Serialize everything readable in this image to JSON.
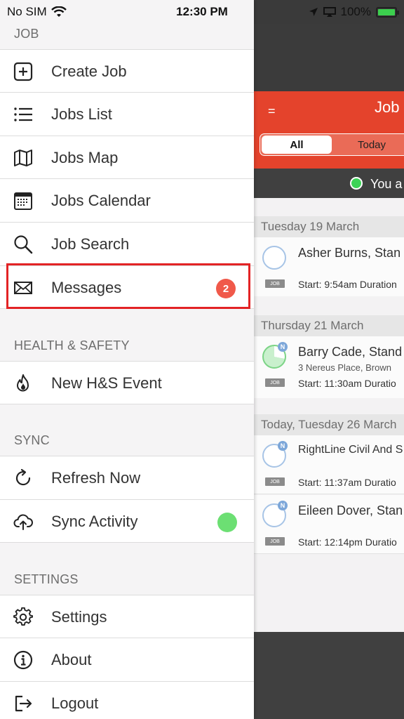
{
  "status_bar": {
    "carrier": "No SIM",
    "time": "12:30 PM",
    "battery": "100%"
  },
  "app": {
    "title": "Job",
    "menu_glyph": "=",
    "segments": {
      "all": "All",
      "today": "Today"
    },
    "online_text": "You a",
    "groups": [
      {
        "date": "Tuesday 19 March",
        "jobs": [
          {
            "title": "Asher Burns, Stan",
            "address": "",
            "tag": "JOB",
            "start": "Start: 9:54am  Duration",
            "badge": ""
          }
        ]
      },
      {
        "date": "Thursday 21 March",
        "jobs": [
          {
            "title": "Barry Cade, Stand",
            "address": "3 Nereus Place, Brown",
            "tag": "JOB",
            "start": "Start: 11:30am  Duratio",
            "badge": "N"
          }
        ]
      },
      {
        "date": "Today, Tuesday 26 March",
        "jobs": [
          {
            "title": "RightLine Civil And S",
            "address": "",
            "tag": "JOB",
            "start": "Start: 11:37am  Duratio",
            "badge": "N"
          },
          {
            "title": "Eileen Dover, Stan",
            "address": "",
            "tag": "JOB",
            "start": "Start: 12:14pm  Duratio",
            "badge": "N"
          }
        ]
      }
    ]
  },
  "drawer": {
    "sections": {
      "job": "JOB",
      "health_safety": "HEALTH & SAFETY",
      "sync": "SYNC",
      "settings": "SETTINGS"
    },
    "items": {
      "create_job": "Create Job",
      "jobs_list": "Jobs List",
      "jobs_map": "Jobs Map",
      "jobs_calendar": "Jobs Calendar",
      "job_search": "Job Search",
      "messages": "Messages",
      "messages_badge": "2",
      "new_hs_event": "New H&S Event",
      "refresh_now": "Refresh Now",
      "sync_activity": "Sync Activity",
      "settings": "Settings",
      "about": "About",
      "logout": "Logout"
    },
    "colors": {
      "accent": "#e4432c",
      "badge": "#f0594a",
      "sync_ok": "#6cdf73",
      "highlight": "#e32325"
    }
  }
}
